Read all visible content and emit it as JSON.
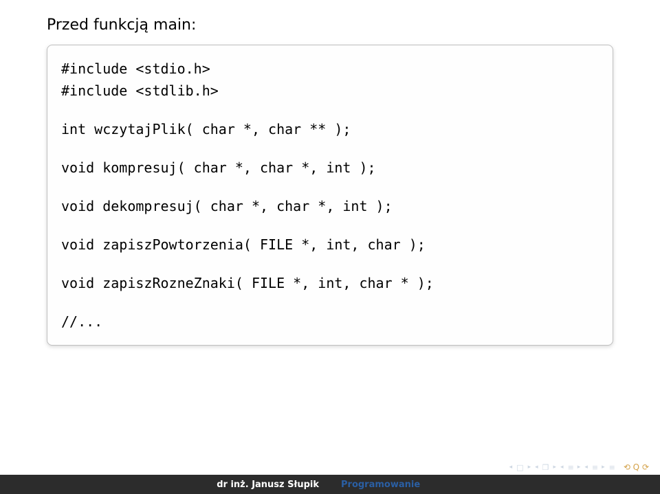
{
  "heading": "Przed funkcją main:",
  "code_lines": [
    "#include <stdio.h>",
    "#include <stdlib.h>",
    "",
    "int wczytajPlik( char *, char ** );",
    "",
    "void kompresuj( char *, char *, int );",
    "",
    "void dekompresuj( char *, char *, int );",
    "",
    "void zapiszPowtorzenia( FILE *, int, char );",
    "",
    "void zapiszRozneZnaki( FILE *, int, char * );",
    "",
    "//..."
  ],
  "footer": {
    "author": "dr inż. Janusz Słupik",
    "title": "Programowanie"
  },
  "nav_icons": {
    "first_tri": "◂",
    "box": "□",
    "fwd_tri": "▸",
    "frame_l": "◂",
    "frame_box": "❐",
    "frame_r": "▸",
    "sect_l": "◂",
    "sect_bars": "≡",
    "sect_r": "▸",
    "subs_l": "◂",
    "subs_bars": "≡",
    "subs_r": "▸",
    "mode_bars": "≡",
    "circles": "⟲ Q ⟳"
  }
}
